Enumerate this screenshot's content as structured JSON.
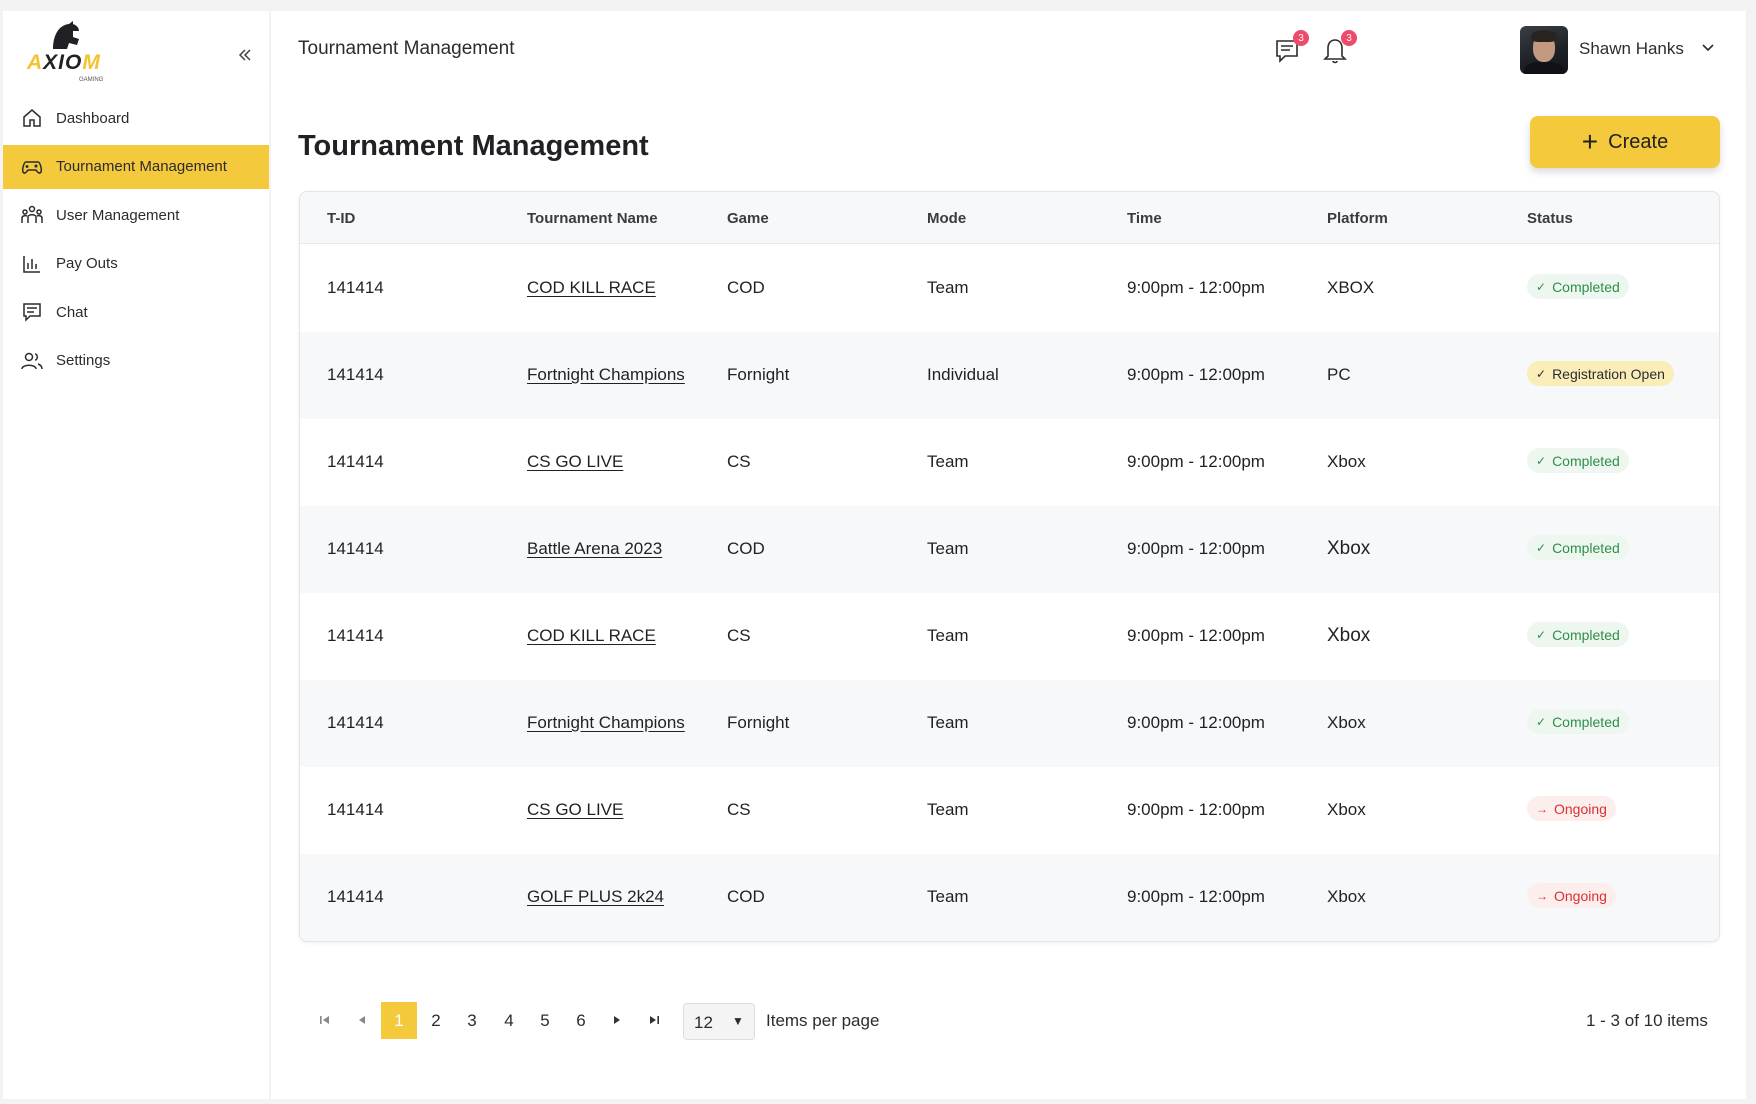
{
  "brand": {
    "name_part1": "A",
    "name_part2": "XIO",
    "name_part3": "M",
    "sub": "GAMING"
  },
  "sidebar": {
    "items": [
      {
        "label": "Dashboard",
        "icon": "home-icon",
        "active": false
      },
      {
        "label": "Tournament Management",
        "icon": "gamepad-icon",
        "active": true
      },
      {
        "label": "User Management",
        "icon": "users-group-icon",
        "active": false
      },
      {
        "label": "Pay Outs",
        "icon": "bar-chart-icon",
        "active": false
      },
      {
        "label": "Chat",
        "icon": "chat-icon",
        "active": false
      },
      {
        "label": "Settings",
        "icon": "people-icon",
        "active": false
      }
    ]
  },
  "header": {
    "title": "Tournament Management",
    "messages_badge": "3",
    "notifications_badge": "3",
    "user_name": "Shawn Hanks"
  },
  "main": {
    "title": "Tournament Management",
    "create_label": "Create",
    "columns": [
      "T-ID",
      "Tournament Name",
      "Game",
      "Mode",
      "Time",
      "Platform",
      "Status"
    ],
    "rows": [
      {
        "tid": "141414",
        "name": "COD KILL RACE",
        "game": "COD",
        "mode": "Team",
        "time": "9:00pm - 12:00pm",
        "platform": "XBOX",
        "status": "Completed",
        "status_type": "completed"
      },
      {
        "tid": "141414",
        "name": "Fortnight Champions",
        "game": "Fornight",
        "mode": "Individual",
        "time": "9:00pm - 12:00pm",
        "platform": "PC",
        "status": "Registration Open",
        "status_type": "registration"
      },
      {
        "tid": "141414",
        "name": "CS GO LIVE",
        "game": "CS",
        "mode": "Team",
        "time": "9:00pm - 12:00pm",
        "platform": "Xbox",
        "status": "Completed",
        "status_type": "completed"
      },
      {
        "tid": "141414",
        "name": "Battle Arena 2023",
        "game": "COD",
        "mode": "Team",
        "time": "9:00pm - 12:00pm",
        "platform": "Xbox",
        "status": "Completed",
        "status_type": "completed"
      },
      {
        "tid": "141414",
        "name": "COD KILL RACE",
        "game": "CS",
        "mode": "Team",
        "time": "9:00pm - 12:00pm",
        "platform": "Xbox",
        "status": "Completed",
        "status_type": "completed"
      },
      {
        "tid": "141414",
        "name": "Fortnight Champions",
        "game": "Fornight",
        "mode": "Team",
        "time": "9:00pm - 12:00pm",
        "platform": "Xbox",
        "status": "Completed",
        "status_type": "completed"
      },
      {
        "tid": "141414",
        "name": "CS GO LIVE",
        "game": "CS",
        "mode": "Team",
        "time": "9:00pm - 12:00pm",
        "platform": "Xbox",
        "status": "Ongoing",
        "status_type": "ongoing"
      },
      {
        "tid": "141414",
        "name": "GOLF PLUS 2k24",
        "game": "COD",
        "mode": "Team",
        "time": "9:00pm - 12:00pm",
        "platform": "Xbox",
        "status": "Ongoing",
        "status_type": "ongoing"
      }
    ]
  },
  "pagination": {
    "pages": [
      "1",
      "2",
      "3",
      "4",
      "5",
      "6"
    ],
    "current_page": "1",
    "per_page": "12",
    "per_page_label": "Items per page",
    "summary": "1 - 3 of 10 items"
  },
  "colors": {
    "accent": "#f5c93c",
    "completed": "#2d8f4a",
    "ongoing": "#d8322f",
    "badge": "#ee4a6b"
  }
}
